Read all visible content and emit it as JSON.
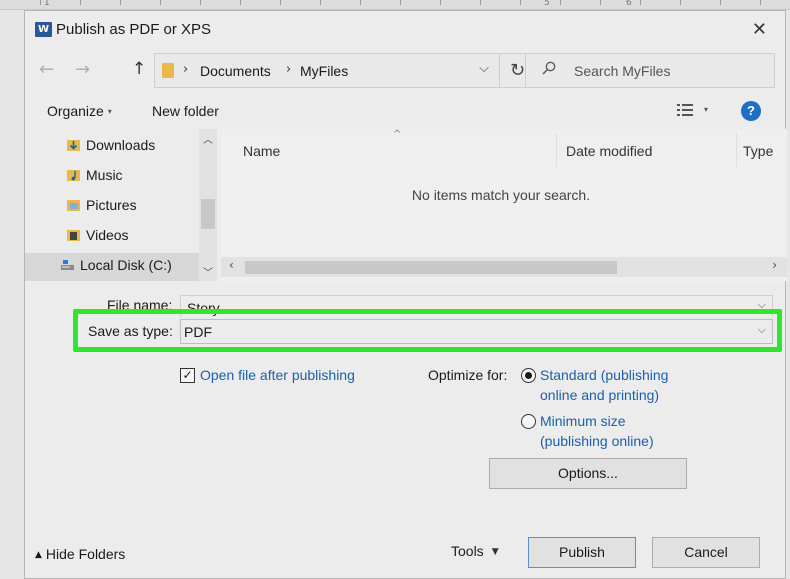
{
  "window": {
    "title": "Publish as PDF or XPS",
    "app_icon": "W",
    "close_label": "✕"
  },
  "ruler": {
    "numbers": [
      "1",
      "5",
      "6"
    ]
  },
  "address_bar": {
    "crumbs": [
      "Documents",
      "MyFiles"
    ],
    "search_placeholder": "Search MyFiles"
  },
  "toolbar": {
    "organize_label": "Organize",
    "new_folder_label": "New folder",
    "help_label": "?"
  },
  "sidebar": {
    "items": [
      {
        "label": "Downloads",
        "icon": "downloads-folder-icon"
      },
      {
        "label": "Music",
        "icon": "music-folder-icon"
      },
      {
        "label": "Pictures",
        "icon": "pictures-folder-icon"
      },
      {
        "label": "Videos",
        "icon": "videos-folder-icon"
      },
      {
        "label": "Local Disk (C:)",
        "icon": "drive-icon",
        "selected": true
      }
    ]
  },
  "file_list": {
    "columns": [
      "Name",
      "Date modified",
      "Type"
    ],
    "empty_message": "No items match your search."
  },
  "form": {
    "file_name_label": "File name:",
    "file_name_value": "Story",
    "save_type_label": "Save as type:",
    "save_type_value": "PDF",
    "open_after_label": "Open file after publishing",
    "open_after_checked": true,
    "optimize_label": "Optimize for:",
    "standard_line1": "Standard (publishing",
    "standard_line2": "online and printing)",
    "minimum_line1": "Minimum size",
    "minimum_line2": "(publishing online)",
    "options_label": "Options..."
  },
  "footer": {
    "hide_folders_label": "Hide Folders",
    "tools_label": "Tools",
    "publish_label": "Publish",
    "cancel_label": "Cancel"
  },
  "colors": {
    "highlight": "#2ee62e",
    "link": "#1d5fa8",
    "help": "#1f6fc7",
    "folder": "#e7b94a"
  }
}
